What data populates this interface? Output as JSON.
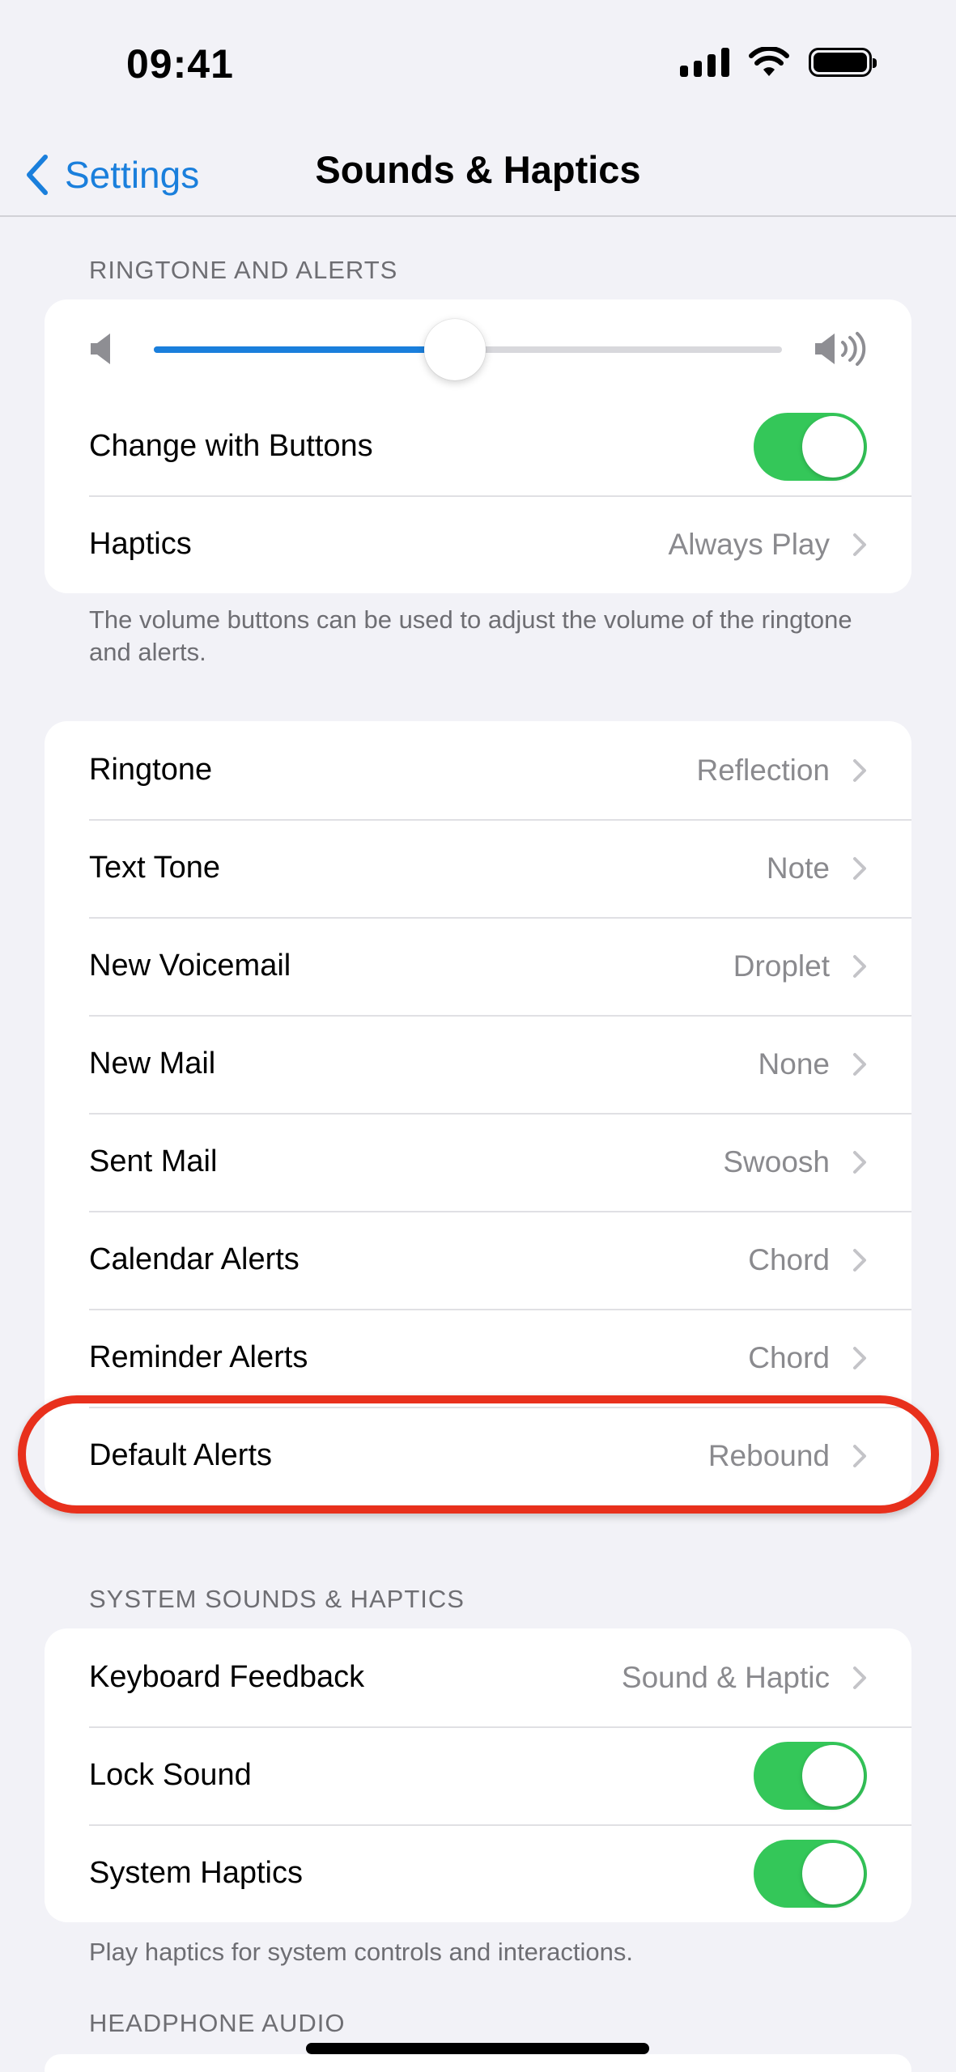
{
  "status_bar": {
    "time": "09:41"
  },
  "nav": {
    "back_label": "Settings",
    "title": "Sounds & Haptics"
  },
  "ringtone_section": {
    "header": "RINGTONE AND ALERTS",
    "volume_level": 0.48,
    "change_with_buttons": {
      "label": "Change with Buttons",
      "on": true
    },
    "haptics": {
      "label": "Haptics",
      "value": "Always Play"
    },
    "footer": "The volume buttons can be used to adjust the volume of the ringtone and alerts."
  },
  "tones": [
    {
      "label": "Ringtone",
      "value": "Reflection"
    },
    {
      "label": "Text Tone",
      "value": "Note"
    },
    {
      "label": "New Voicemail",
      "value": "Droplet"
    },
    {
      "label": "New Mail",
      "value": "None"
    },
    {
      "label": "Sent Mail",
      "value": "Swoosh"
    },
    {
      "label": "Calendar Alerts",
      "value": "Chord"
    },
    {
      "label": "Reminder Alerts",
      "value": "Chord"
    },
    {
      "label": "Default Alerts",
      "value": "Rebound"
    }
  ],
  "system_section": {
    "header": "SYSTEM SOUNDS & HAPTICS",
    "keyboard_feedback": {
      "label": "Keyboard Feedback",
      "value": "Sound & Haptic"
    },
    "lock_sound": {
      "label": "Lock Sound",
      "on": true
    },
    "system_haptics": {
      "label": "System Haptics",
      "on": true
    },
    "footer": "Play haptics for system controls and interactions."
  },
  "headphone_section": {
    "header": "HEADPHONE AUDIO"
  },
  "colors": {
    "accent": "#1a7fdc",
    "toggle_on": "#34c759",
    "highlight": "#e8301c",
    "background": "#f2f2f7"
  }
}
